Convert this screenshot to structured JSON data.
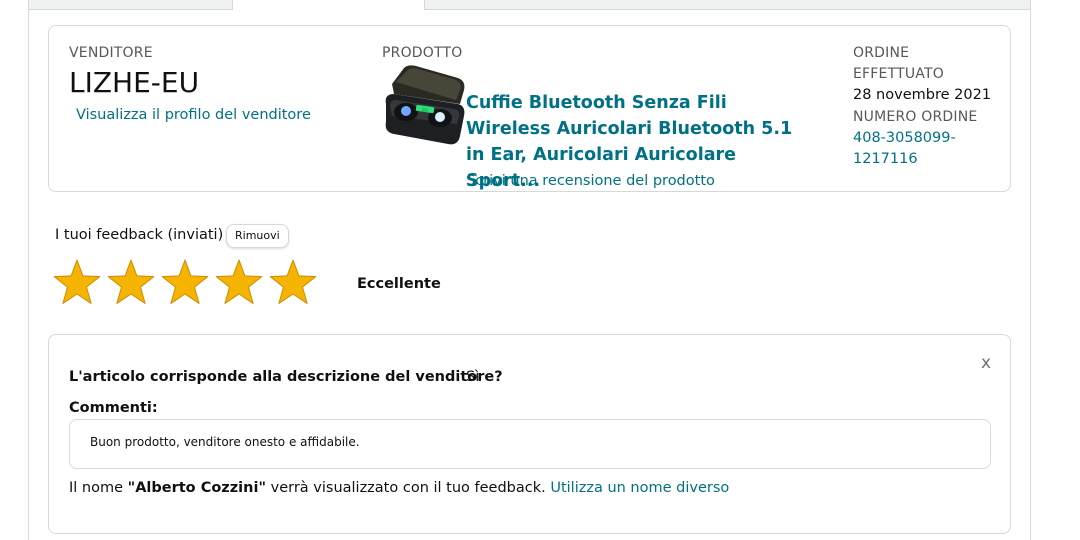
{
  "order": {
    "seller_label": "VENDITORE",
    "seller_name": "LIZHE-EU",
    "seller_profile_link": "Visualizza il profilo del venditore",
    "product_label": "PRODOTTO",
    "product_title": "Cuffie Bluetooth Senza Fili Wireless Auricolari Bluetooth 5.1 in Ear, Auricolari Auricolare Sport...",
    "review_link": "Scrivi una recensione del prodotto",
    "order_label_1": "ORDINE",
    "order_label_2": "EFFETTUATO",
    "order_date": "28 novembre 2021",
    "order_number_label": "NUMERO ORDINE",
    "order_number": "408-3058099-1217116"
  },
  "feedback": {
    "label": "I tuoi feedback (inviati)",
    "remove_button": "Rimuovi",
    "rating": 5,
    "rating_max": 5,
    "rating_text": "Eccellente",
    "star_color": "#f5b400"
  },
  "details": {
    "close_label": "x",
    "question": "L'articolo corrisponde alla descrizione del venditore?",
    "answer": "Sì",
    "comments_label": "Commenti:",
    "comment_text": "Buon prodotto, venditore onesto e affidabile.",
    "name_prefix": "Il nome",
    "name_value": "\"Alberto Cozzini\"",
    "name_suffix": "verrà visualizzato con il tuo feedback.",
    "name_change_link": "Utilizza un nome diverso"
  },
  "colors": {
    "link": "#007185",
    "border": "#d5d9d9",
    "star": "#f5b400"
  }
}
